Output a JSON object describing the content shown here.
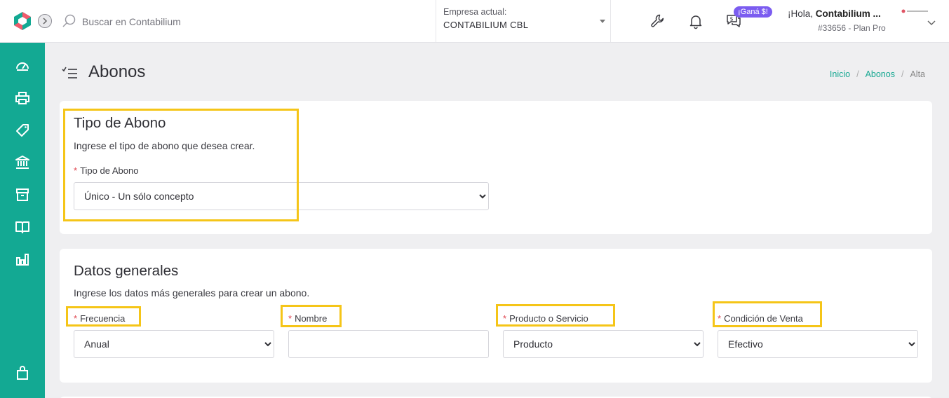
{
  "topbar": {
    "search_placeholder": "Buscar en Contabilium",
    "company_label": "Empresa actual:",
    "company_value": "CONTABILIUM CBL",
    "badge": "¡Ganá $!",
    "greeting_prefix": "¡Hola, ",
    "user_name": "Contabilium ...",
    "user_plan": "#33656 - Plan Pro"
  },
  "sidebar": {
    "items": [
      "dashboard-icon",
      "printer-icon",
      "tag-icon",
      "bank-icon",
      "box-icon",
      "book-icon",
      "chart-icon",
      "bag-icon"
    ]
  },
  "page": {
    "title": "Abonos",
    "breadcrumb": [
      "Inicio",
      "Abonos",
      "Alta"
    ]
  },
  "tipo": {
    "title": "Tipo de Abono",
    "desc": "Ingrese el tipo de abono que desea crear.",
    "label": "Tipo de Abono",
    "value": "Único - Un sólo concepto"
  },
  "datos": {
    "title": "Datos generales",
    "desc": "Ingrese los datos más generales para crear un abono.",
    "frecuencia_label": "Frecuencia",
    "frecuencia_value": "Anual",
    "nombre_label": "Nombre",
    "nombre_value": "",
    "producto_label": "Producto o Servicio",
    "producto_value": "Producto",
    "condicion_label": "Condición de Venta",
    "condicion_value": "Efectivo"
  },
  "colors": {
    "accent": "#13a993",
    "highlight": "#f5c518",
    "required": "#e0454f",
    "badge": "#7b5cf0"
  }
}
